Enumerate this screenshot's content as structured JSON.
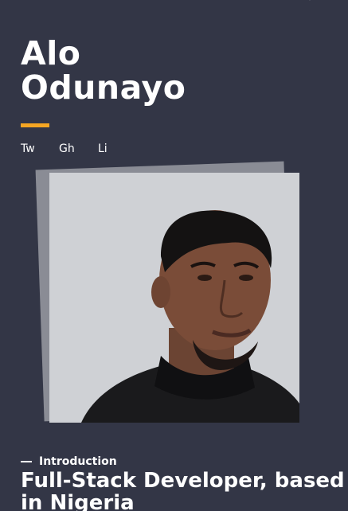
{
  "header": {
    "first_name": "Alo",
    "last_name": "Odunayo"
  },
  "accent_color": "#F5A623",
  "social_links": [
    {
      "label": "Tw",
      "icon": "twitter"
    },
    {
      "label": "Gh",
      "icon": "github"
    },
    {
      "label": "Li",
      "icon": "linkedin"
    }
  ],
  "intro": {
    "section_label": "Introduction",
    "headline_line1": "Full-Stack Developer, based",
    "headline_line2": "in Nigeria"
  }
}
